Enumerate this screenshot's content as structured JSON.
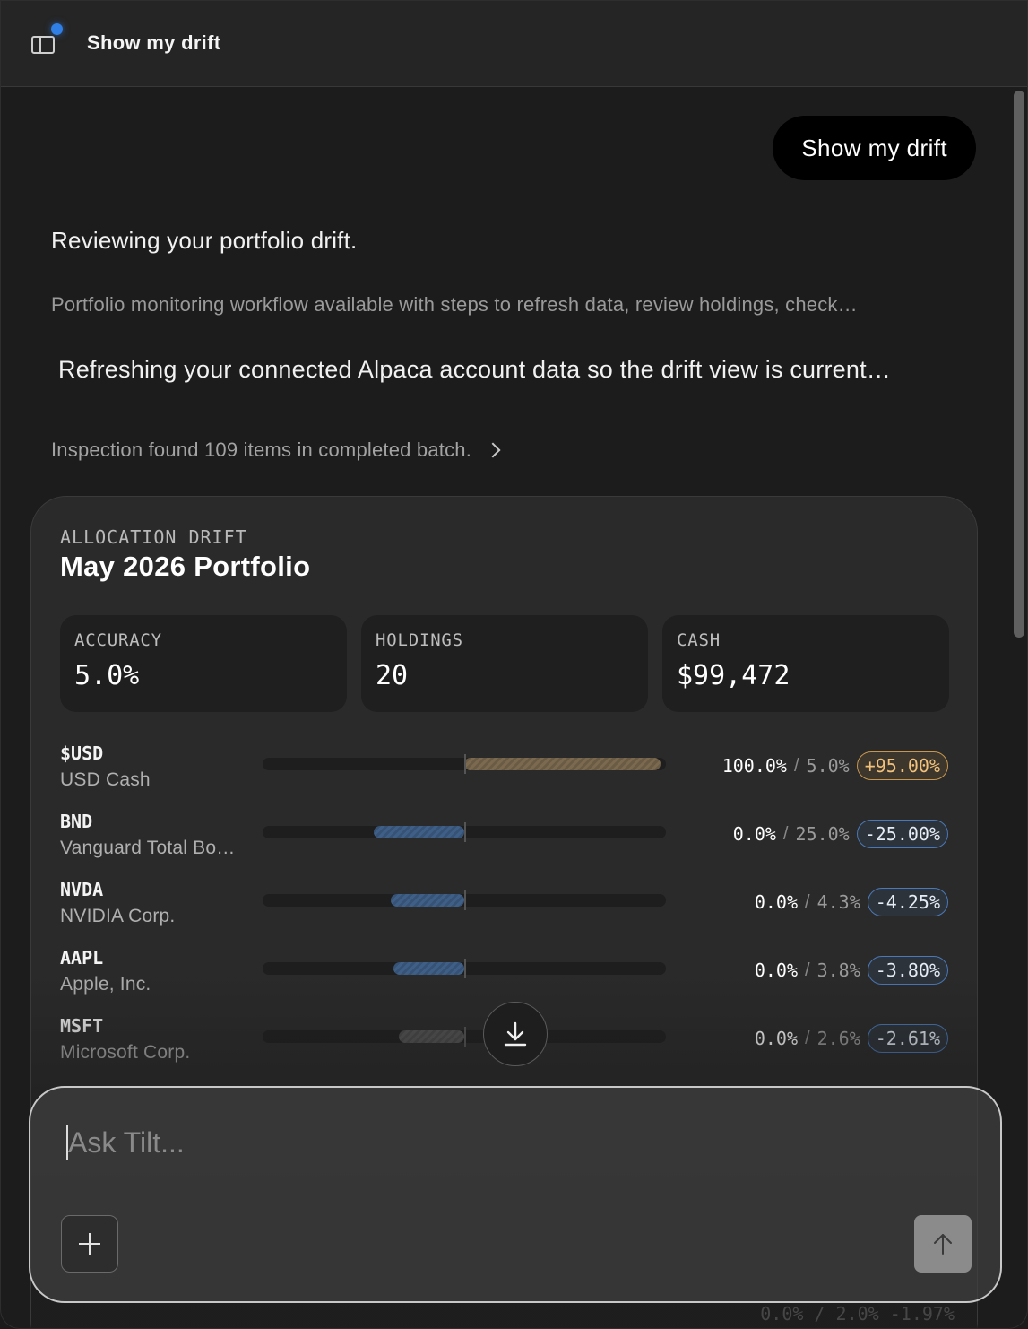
{
  "header": {
    "title": "Show my drift",
    "notify_color": "#2f7fe6"
  },
  "conversation": {
    "user_message": "Show my drift",
    "assistant_main": "Reviewing your portfolio drift.",
    "assistant_sub": "Portfolio monitoring workflow available with steps to refresh data, review holdings, check…",
    "assistant_refresh": "Refreshing your connected Alpaca account data so the drift view is current…",
    "inspection": "Inspection found 109 items in completed batch."
  },
  "card": {
    "kicker": "ALLOCATION DRIFT",
    "title": "May 2026 Portfolio",
    "stats": [
      {
        "label": "ACCURACY",
        "value": "5.0%"
      },
      {
        "label": "HOLDINGS",
        "value": "20"
      },
      {
        "label": "CASH",
        "value": "$99,472"
      }
    ],
    "holdings": [
      {
        "ticker": "$USD",
        "name": "USD Cash",
        "current": "100.0%",
        "target": "5.0%",
        "drift": "+95.00%",
        "drift_value": 95.0,
        "direction": "pos"
      },
      {
        "ticker": "BND",
        "name": "Vanguard Total Bo…",
        "current": "0.0%",
        "target": "25.0%",
        "drift": "-25.00%",
        "drift_value": -25.0,
        "direction": "neg"
      },
      {
        "ticker": "NVDA",
        "name": "NVIDIA Corp.",
        "current": "0.0%",
        "target": "4.3%",
        "drift": "-4.25%",
        "drift_value": -4.25,
        "direction": "neg"
      },
      {
        "ticker": "AAPL",
        "name": "Apple, Inc.",
        "current": "0.0%",
        "target": "3.8%",
        "drift": "-3.80%",
        "drift_value": -3.8,
        "direction": "neg"
      },
      {
        "ticker": "MSFT",
        "name": "Microsoft Corp.",
        "current": "0.0%",
        "target": "2.6%",
        "drift": "-2.61%",
        "drift_value": -2.61,
        "direction": "neg"
      }
    ],
    "partial_row": {
      "current": "0.0%",
      "target": "2.0%",
      "drift": "-1.97%"
    }
  },
  "composer": {
    "placeholder": "Ask Tilt..."
  },
  "colors": {
    "positive": "#c8964c",
    "negative": "#4a78b8",
    "background": "#1c1c1c"
  }
}
